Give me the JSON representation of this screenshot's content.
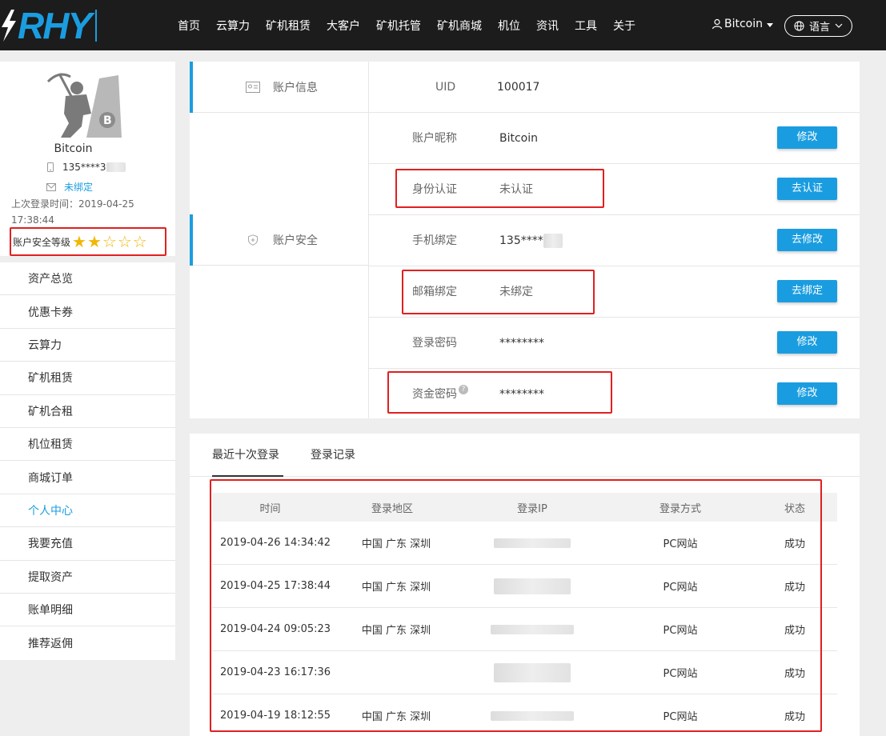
{
  "brand": {
    "logo_text": "RHY"
  },
  "nav": {
    "items": [
      "首页",
      "云算力",
      "矿机租赁",
      "大客户",
      "矿机托管",
      "矿机商城",
      "机位",
      "资讯",
      "工具",
      "关于"
    ],
    "user_label": "Bitcoin",
    "lang_label": "语言"
  },
  "profile": {
    "name": "Bitcoin",
    "phone": "135****3",
    "email_status": "未绑定",
    "last_login": "上次登录时间：2019-04-25 17:38:44",
    "security_label": "账户安全等级",
    "security_stars_filled": 2,
    "security_stars_total": 5
  },
  "sidebar": {
    "items": [
      "资产总览",
      "优惠卡券",
      "云算力",
      "矿机租赁",
      "矿机合租",
      "机位租赁",
      "商城订单",
      "个人中心",
      "我要充值",
      "提取资产",
      "账单明细",
      "推荐返佣"
    ],
    "active_index": 7
  },
  "account": {
    "section_info": "账户信息",
    "section_security": "账户安全",
    "rows": [
      {
        "label": "UID",
        "value": "100017",
        "button": ""
      },
      {
        "label": "账户昵称",
        "value": "Bitcoin",
        "button": "修改"
      },
      {
        "label": "身份认证",
        "value": "未认证",
        "button": "去认证"
      },
      {
        "label": "手机绑定",
        "value": "135****3",
        "button": "去修改"
      },
      {
        "label": "邮箱绑定",
        "value": "未绑定",
        "button": "去绑定"
      },
      {
        "label": "登录密码",
        "value": "********",
        "button": "修改"
      },
      {
        "label": "资金密码",
        "value": "********",
        "button": "修改"
      }
    ]
  },
  "login": {
    "tabs": [
      "最近十次登录",
      "登录记录"
    ],
    "headers": [
      "时间",
      "登录地区",
      "登录IP",
      "登录方式",
      "状态"
    ],
    "rows": [
      {
        "time": "2019-04-26 14:34:42",
        "region": "中国 广东 深圳",
        "method": "PC网站",
        "status": "成功"
      },
      {
        "time": "2019-04-25 17:38:44",
        "region": "中国 广东 深圳",
        "method": "PC网站",
        "status": "成功"
      },
      {
        "time": "2019-04-24 09:05:23",
        "region": "中国 广东 深圳",
        "method": "PC网站",
        "status": "成功"
      },
      {
        "time": "2019-04-23 16:17:36",
        "region": "",
        "method": "PC网站",
        "status": "成功"
      },
      {
        "time": "2019-04-19 18:12:55",
        "region": "中国 广东 深圳",
        "method": "PC网站",
        "status": "成功"
      }
    ]
  }
}
